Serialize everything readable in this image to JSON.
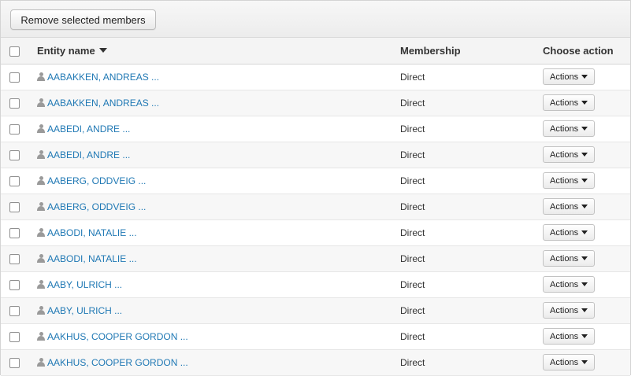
{
  "toolbar": {
    "remove_label": "Remove selected members"
  },
  "table": {
    "headers": {
      "entity_name": "Entity name",
      "membership": "Membership",
      "choose_action": "Choose action"
    },
    "actions_label": "Actions",
    "rows": [
      {
        "name": "AABAKKEN, ANDREAS ...",
        "membership": "Direct"
      },
      {
        "name": "AABAKKEN, ANDREAS ...",
        "membership": "Direct"
      },
      {
        "name": "AABEDI, ANDRE ...",
        "membership": "Direct"
      },
      {
        "name": "AABEDI, ANDRE ...",
        "membership": "Direct"
      },
      {
        "name": "AABERG, ODDVEIG ...",
        "membership": "Direct"
      },
      {
        "name": "AABERG, ODDVEIG ...",
        "membership": "Direct"
      },
      {
        "name": "AABODI, NATALIE ...",
        "membership": "Direct"
      },
      {
        "name": "AABODI, NATALIE ...",
        "membership": "Direct"
      },
      {
        "name": "AABY, ULRICH ...",
        "membership": "Direct"
      },
      {
        "name": "AABY, ULRICH ...",
        "membership": "Direct"
      },
      {
        "name": "AAKHUS, COOPER GORDON ...",
        "membership": "Direct"
      },
      {
        "name": "AAKHUS, COOPER GORDON ...",
        "membership": "Direct"
      }
    ]
  },
  "icons": {
    "sort": "sort-descending-icon",
    "user": "user-icon",
    "caret": "caret-down-icon"
  },
  "colors": {
    "link": "#1f78b4",
    "icon_gray": "#9a9a9a"
  }
}
